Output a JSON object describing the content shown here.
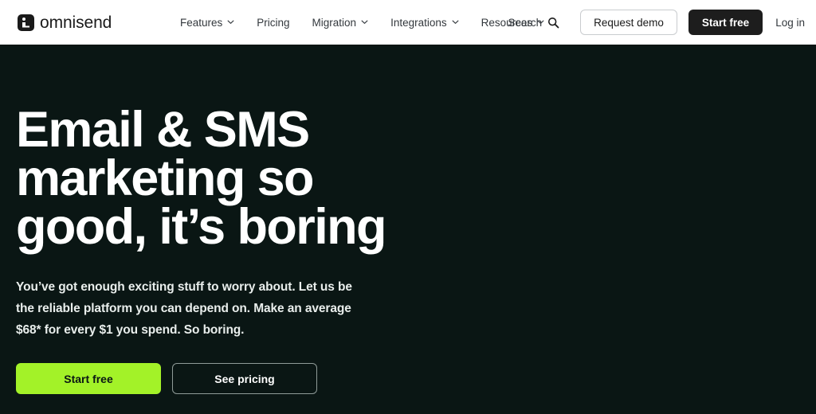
{
  "colors": {
    "nav_background": "#ffffff",
    "hero_background": "#0a1614",
    "accent_green": "#a3f228",
    "dark_button": "#1d1d1d",
    "heading_text": "#ffffff",
    "nav_text": "#33383d",
    "outline_border": "#8f9b98"
  },
  "navbar": {
    "brand": {
      "name": "omnisend",
      "mark_icon": "omnisend-logo-icon"
    },
    "links": [
      {
        "label": "Features",
        "has_dropdown": true
      },
      {
        "label": "Pricing",
        "has_dropdown": false
      },
      {
        "label": "Migration",
        "has_dropdown": true
      },
      {
        "label": "Integrations",
        "has_dropdown": true
      },
      {
        "label": "Resources",
        "has_dropdown": true
      }
    ],
    "search": {
      "label": "Search",
      "icon": "search-icon"
    },
    "request_demo_label": "Request demo",
    "start_free_label": "Start free",
    "login_label": "Log in"
  },
  "hero": {
    "headline": "Email & SMS marketing so good, it’s boring",
    "subcopy": "You’ve got enough exciting stuff to worry about. Let us be the reliable platform you can depend on. Make an average $68* for every $1 you spend. So boring.",
    "primary_cta_label": "Start free",
    "secondary_cta_label": "See pricing"
  }
}
